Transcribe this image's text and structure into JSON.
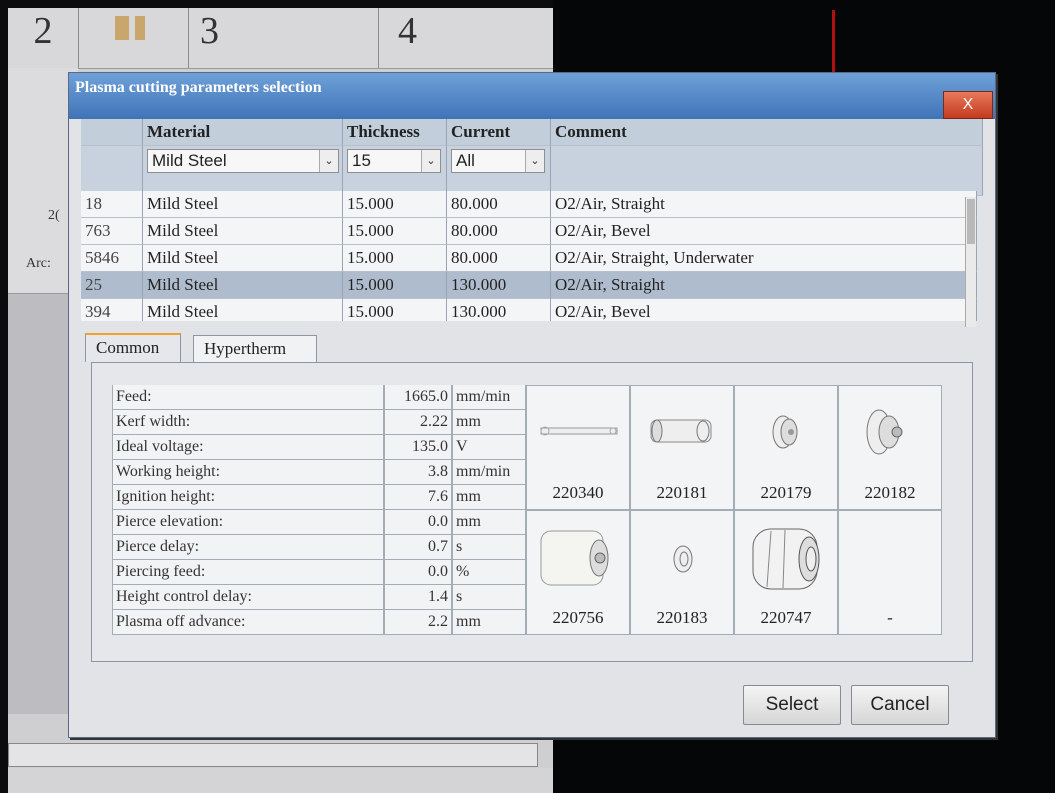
{
  "background": {
    "toolbar_numbers": [
      "2",
      "3",
      "4"
    ],
    "side_labels": [
      "2(",
      "Arc:"
    ]
  },
  "dialog": {
    "title": "Plasma cutting parameters selection",
    "close_label": "X"
  },
  "grid": {
    "headers": [
      "Material",
      "Thickness",
      "Current",
      "Comment"
    ],
    "filters": {
      "material": "Mild Steel",
      "thickness": "15",
      "current": "All"
    },
    "rows": [
      {
        "id": "18",
        "material": "Mild Steel",
        "thickness": "15.000",
        "current": "80.000",
        "comment": "O2/Air, Straight"
      },
      {
        "id": "763",
        "material": "Mild Steel",
        "thickness": "15.000",
        "current": "80.000",
        "comment": "O2/Air, Bevel"
      },
      {
        "id": "5846",
        "material": "Mild Steel",
        "thickness": "15.000",
        "current": "80.000",
        "comment": "O2/Air, Straight, Underwater"
      },
      {
        "id": "25",
        "material": "Mild Steel",
        "thickness": "15.000",
        "current": "130.000",
        "comment": "O2/Air, Straight",
        "selected": true
      },
      {
        "id": "394",
        "material": "Mild Steel",
        "thickness": "15.000",
        "current": "130.000",
        "comment": "O2/Air, Bevel"
      }
    ]
  },
  "tabs": [
    "Common",
    "Hypertherm"
  ],
  "active_tab": "Common",
  "params": [
    {
      "label": "Feed:",
      "value": "1665.0",
      "unit": "mm/min"
    },
    {
      "label": "Kerf width:",
      "value": "2.22",
      "unit": "mm"
    },
    {
      "label": "Ideal voltage:",
      "value": "135.0",
      "unit": "V"
    },
    {
      "label": "Working height:",
      "value": "3.8",
      "unit": "mm/min"
    },
    {
      "label": "Ignition height:",
      "value": "7.6",
      "unit": "mm"
    },
    {
      "label": "Pierce elevation:",
      "value": "0.0",
      "unit": "mm"
    },
    {
      "label": "Pierce delay:",
      "value": "0.7",
      "unit": "s"
    },
    {
      "label": "Piercing feed:",
      "value": "0.0",
      "unit": "%"
    },
    {
      "label": "Height control delay:",
      "value": "1.4",
      "unit": "s"
    },
    {
      "label": "Plasma off advance:",
      "value": "2.2",
      "unit": "mm"
    }
  ],
  "consumables": [
    {
      "part_no": "220340",
      "icon": "electrode-rod-icon"
    },
    {
      "part_no": "220181",
      "icon": "swirl-ring-icon"
    },
    {
      "part_no": "220179",
      "icon": "nozzle-icon"
    },
    {
      "part_no": "220182",
      "icon": "retaining-cap-icon"
    },
    {
      "part_no": "220756",
      "icon": "shield-cap-icon"
    },
    {
      "part_no": "220183",
      "icon": "water-tube-icon"
    },
    {
      "part_no": "220747",
      "icon": "outer-cap-icon"
    },
    {
      "part_no": "-",
      "icon": ""
    }
  ],
  "buttons": {
    "select": "Select",
    "cancel": "Cancel"
  }
}
